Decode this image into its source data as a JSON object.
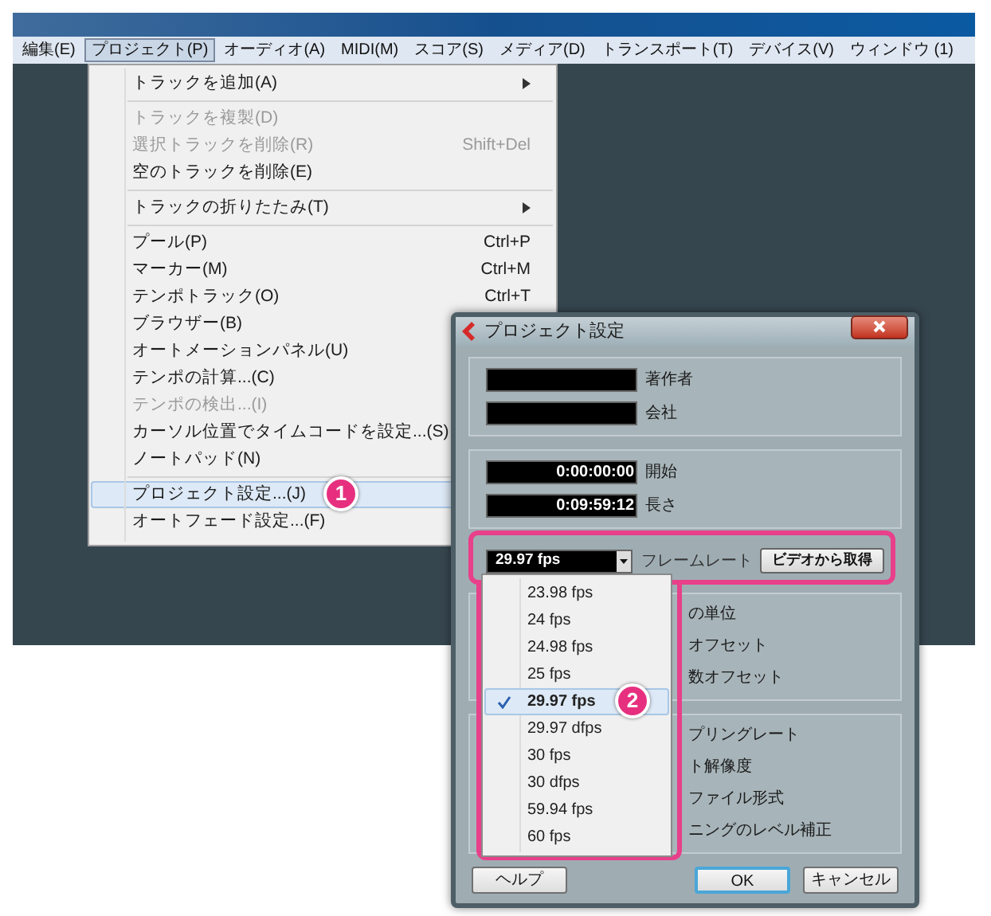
{
  "menubar": [
    {
      "label": "編集(E)",
      "selected": false
    },
    {
      "label": "プロジェクト(P)",
      "selected": true
    },
    {
      "label": "オーディオ(A)",
      "selected": false
    },
    {
      "label": "MIDI(M)",
      "selected": false
    },
    {
      "label": "スコア(S)",
      "selected": false
    },
    {
      "label": "メディア(D)",
      "selected": false
    },
    {
      "label": "トランスポート(T)",
      "selected": false
    },
    {
      "label": "デバイス(V)",
      "selected": false
    },
    {
      "label": "ウィンドウ (1)",
      "selected": false
    }
  ],
  "project_menu": [
    {
      "kind": "item",
      "label": "トラックを追加(A)",
      "submenu": true,
      "disabled": false,
      "selected": false
    },
    {
      "kind": "separator"
    },
    {
      "kind": "item",
      "label": "トラックを複製(D)",
      "submenu": false,
      "disabled": true,
      "selected": false
    },
    {
      "kind": "item",
      "label": "選択トラックを削除(R)",
      "shortcut": "Shift+Del",
      "submenu": false,
      "disabled": true,
      "selected": false
    },
    {
      "kind": "item",
      "label": "空のトラックを削除(E)",
      "submenu": false,
      "disabled": false,
      "selected": false
    },
    {
      "kind": "separator"
    },
    {
      "kind": "item",
      "label": "トラックの折りたたみ(T)",
      "submenu": true,
      "disabled": false,
      "selected": false
    },
    {
      "kind": "separator"
    },
    {
      "kind": "item",
      "label": "プール(P)",
      "shortcut": "Ctrl+P",
      "submenu": false,
      "disabled": false,
      "selected": false
    },
    {
      "kind": "item",
      "label": "マーカー(M)",
      "shortcut": "Ctrl+M",
      "submenu": false,
      "disabled": false,
      "selected": false
    },
    {
      "kind": "item",
      "label": "テンポトラック(O)",
      "shortcut": "Ctrl+T",
      "submenu": false,
      "disabled": false,
      "selected": false
    },
    {
      "kind": "item",
      "label": "ブラウザー(B)",
      "submenu": false,
      "disabled": false,
      "selected": false
    },
    {
      "kind": "item",
      "label": "オートメーションパネル(U)",
      "submenu": false,
      "disabled": false,
      "selected": false
    },
    {
      "kind": "item",
      "label": "テンポの計算...(C)",
      "submenu": false,
      "disabled": false,
      "selected": false
    },
    {
      "kind": "item",
      "label": "テンポの検出...(I)",
      "submenu": false,
      "disabled": true,
      "selected": false
    },
    {
      "kind": "item",
      "label": "カーソル位置でタイムコードを設定...(S)",
      "submenu": false,
      "disabled": false,
      "selected": false
    },
    {
      "kind": "item",
      "label": "ノートパッド(N)",
      "submenu": false,
      "disabled": false,
      "selected": false
    },
    {
      "kind": "separator"
    },
    {
      "kind": "item",
      "label": "プロジェクト設定...(J)",
      "submenu": false,
      "disabled": false,
      "selected": true
    },
    {
      "kind": "item",
      "label": "オートフェード設定...(F)",
      "submenu": false,
      "disabled": false,
      "selected": false
    }
  ],
  "dialog": {
    "title": "プロジェクト設定",
    "info_fields": [
      {
        "label": "著作者"
      },
      {
        "label": "会社"
      }
    ],
    "time_fields": [
      {
        "value": "0:00:00:00",
        "label": "開始"
      },
      {
        "value": "0:09:59:12",
        "label": "長さ"
      }
    ],
    "frame_rate": {
      "value": "29.97 fps",
      "label": "フレームレート",
      "button": "ビデオから取得"
    },
    "option_groups": [
      {
        "labels": [
          "の単位",
          "オフセット",
          "数オフセット"
        ]
      },
      {
        "labels": [
          "プリングレート",
          "ト解像度",
          "ファイル形式",
          "ニングのレベル補正"
        ]
      }
    ],
    "buttons": [
      {
        "label": "ヘルプ",
        "default": false
      },
      {
        "label": "OK",
        "default": true
      },
      {
        "label": "キャンセル",
        "default": false
      }
    ]
  },
  "frame_rate_list": [
    {
      "label": "23.98 fps",
      "selected": false
    },
    {
      "label": "24 fps",
      "selected": false
    },
    {
      "label": "24.98 fps",
      "selected": false
    },
    {
      "label": "25 fps",
      "selected": false
    },
    {
      "label": "29.97 fps",
      "selected": true
    },
    {
      "label": "29.97 dfps",
      "selected": false
    },
    {
      "label": "30 fps",
      "selected": false
    },
    {
      "label": "30 dfps",
      "selected": false
    },
    {
      "label": "59.94 fps",
      "selected": false
    },
    {
      "label": "60 fps",
      "selected": false
    }
  ],
  "annotations": [
    "1",
    "2"
  ]
}
